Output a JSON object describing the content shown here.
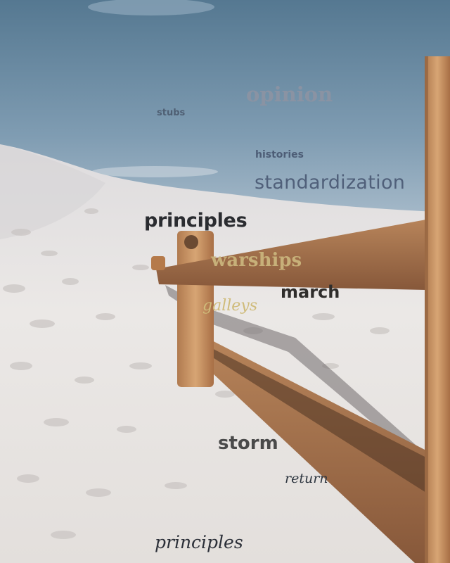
{
  "scene": {
    "description_icon": "desert-sand-dune-fence-photo",
    "colors": {
      "sky_top": "#5b7d96",
      "sky_bottom": "#9fb6c4",
      "sand": "#ece9e6",
      "wood": "#a8734a",
      "wood_dark": "#5a3a22"
    }
  },
  "words": {
    "opinion": {
      "text": "opinion",
      "color": "#8a93a3"
    },
    "stubs": {
      "text": "stubs",
      "color": "#4f5f73"
    },
    "histories": {
      "text": "histories",
      "color": "#4d5d76"
    },
    "standardization": {
      "text": "standardization",
      "color": "#50607a"
    },
    "principles_1": {
      "text": "principles",
      "color": "#2a2c30"
    },
    "warships": {
      "text": "warships",
      "color": "#c7b079"
    },
    "march": {
      "text": "march",
      "color": "#2f2d2b"
    },
    "galleys": {
      "text": "galleys",
      "color": "#cfbb7a"
    },
    "storm": {
      "text": "storm",
      "color": "#4a4a4a"
    },
    "return": {
      "text": "return",
      "color": "#2e3640"
    },
    "principles_2": {
      "text": "principles",
      "color": "#2b2f38"
    }
  }
}
